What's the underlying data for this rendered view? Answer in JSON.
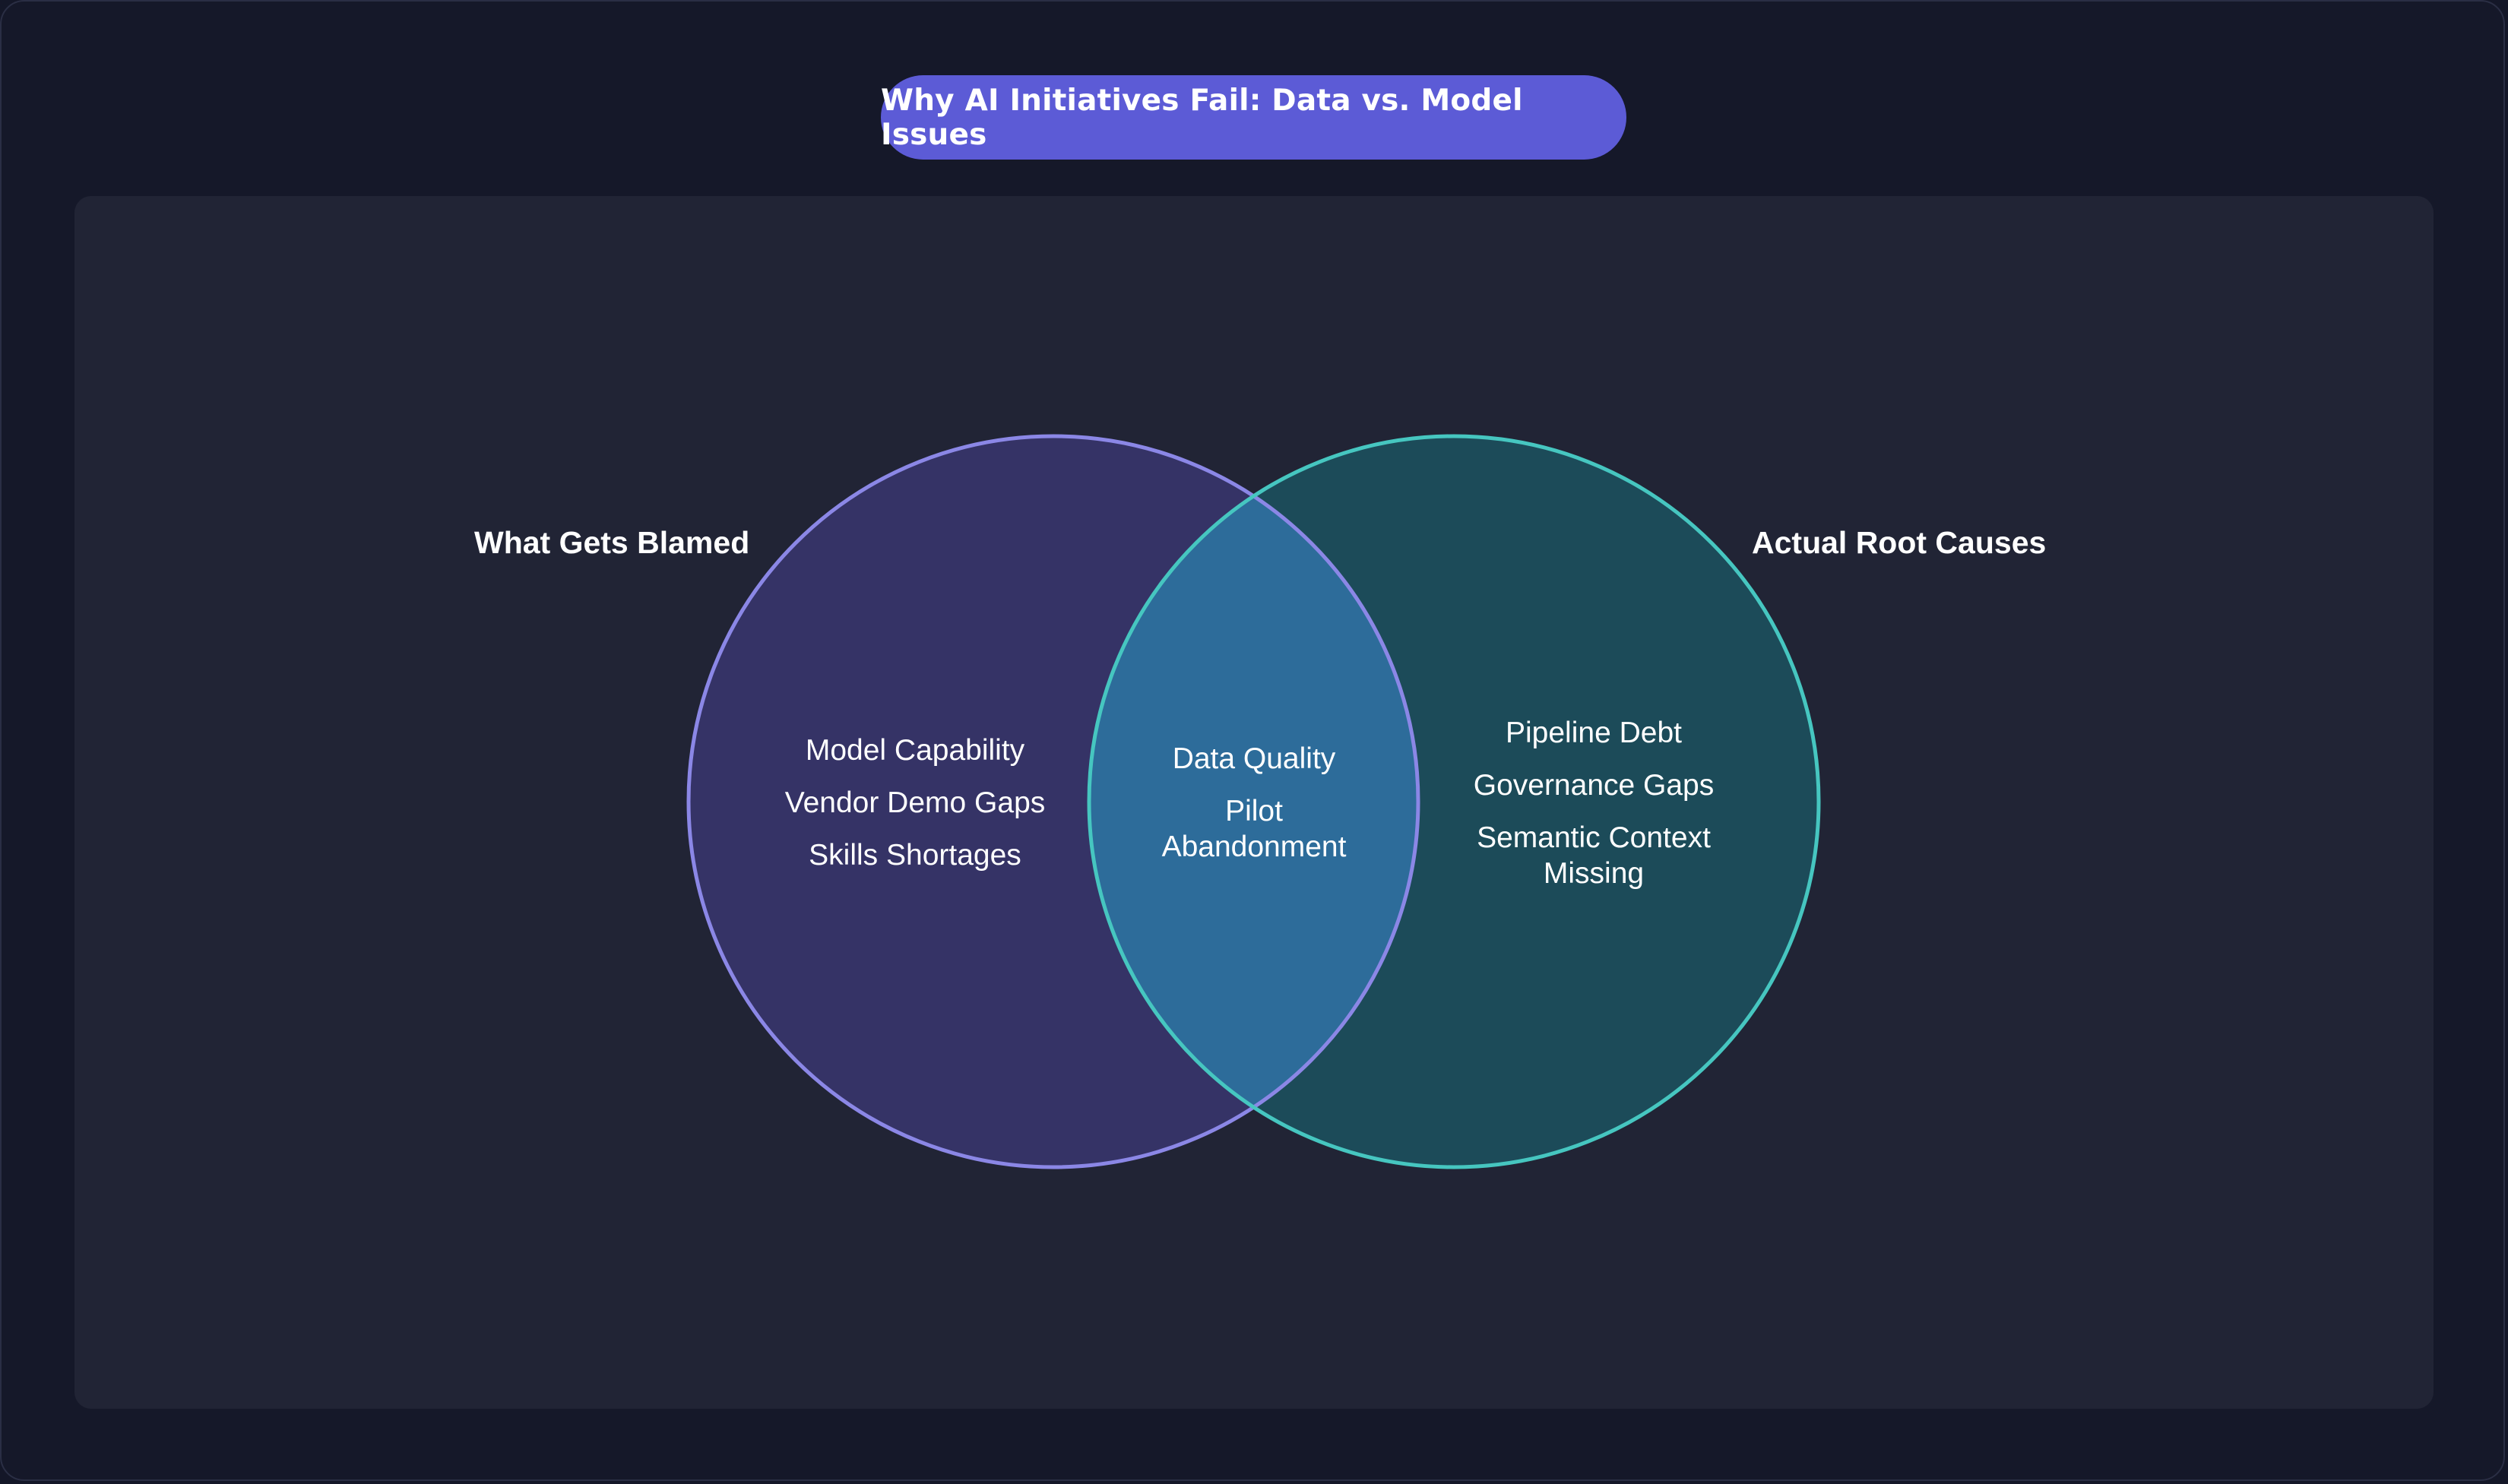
{
  "title": "Why AI Initiatives Fail: Data vs. Model Issues",
  "colors": {
    "background": "#151829",
    "panel": "#212435",
    "title_pill": "#5c5bd6",
    "left_fill": "#353366",
    "left_stroke": "#8b87e6",
    "right_fill": "#1c4b59",
    "right_stroke": "#46c6c0",
    "overlap_fill": "#2d6c9a"
  },
  "sets": {
    "left": {
      "label": "What Gets Blamed",
      "items": [
        "Model Capability",
        "Vendor Demo Gaps",
        "Skills Shortages"
      ]
    },
    "right": {
      "label": "Actual Root Causes",
      "items": [
        "Pipeline Debt",
        "Governance Gaps",
        "Semantic Context Missing"
      ]
    },
    "overlap": {
      "items": [
        "Data Quality",
        "Pilot Abandonment"
      ]
    }
  }
}
